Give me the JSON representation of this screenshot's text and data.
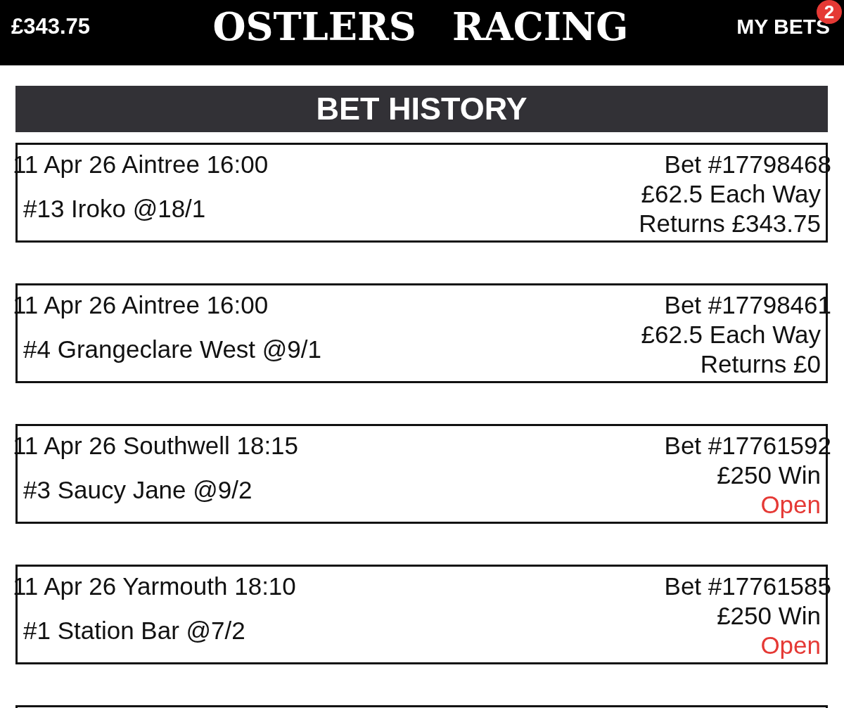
{
  "header": {
    "balance": "£343.75",
    "logo": "OSTLERS RACING",
    "my_bets": {
      "label": "MY BETS",
      "badge": "2"
    }
  },
  "page_title": "BET HISTORY",
  "bets": [
    {
      "race": "11 Apr 26 Aintree 16:00",
      "bet_number": "Bet #17798468",
      "selection": "#13 Iroko @18/1",
      "stake": "£62.5 Each Way",
      "result": {
        "text": "Returns £343.75",
        "open": false
      }
    },
    {
      "race": "11 Apr 26 Aintree 16:00",
      "bet_number": "Bet #17798461",
      "selection": "#4 Grangeclare West @9/1",
      "stake": "£62.5 Each Way",
      "result": {
        "text": "Returns £0",
        "open": false
      }
    },
    {
      "race": "11 Apr 26 Southwell 18:15",
      "bet_number": "Bet #17761592",
      "selection": "#3 Saucy Jane @9/2",
      "stake": "£250 Win",
      "result": {
        "text": "Open",
        "open": true
      }
    },
    {
      "race": "11 Apr 26 Yarmouth 18:10",
      "bet_number": "Bet #17761585",
      "selection": "#1 Station Bar @7/2",
      "stake": "£250 Win",
      "result": {
        "text": "Open",
        "open": true
      }
    }
  ]
}
